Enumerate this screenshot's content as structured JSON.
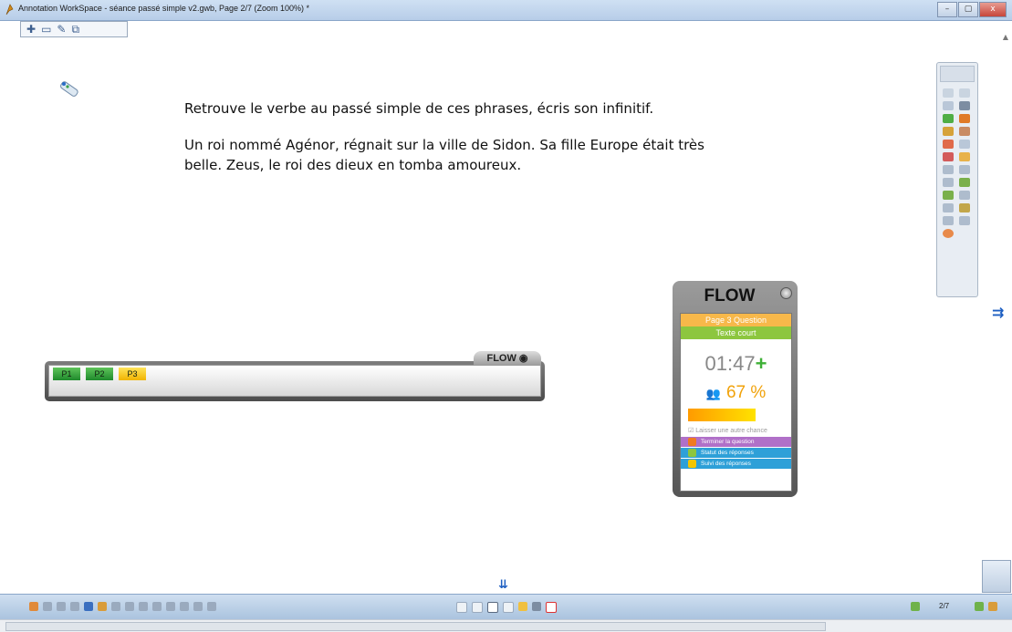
{
  "window": {
    "title": "Annotation WorkSpace - séance passé simple v2.gwb, Page 2/7  (Zoom 100%) *",
    "buttons": [
      "–",
      "▢",
      "x"
    ]
  },
  "mini_toolbar": {
    "icons": [
      "zoom-in-icon",
      "minimize-icon",
      "edit-icon",
      "copy-icon"
    ]
  },
  "content": {
    "instruction": "Retrouve le verbe au passé simple de ces phrases, écris son infinitif.",
    "paragraph_line1": "Un roi nommé Agénor, régnait sur la ville de Sidon. Sa fille Europe était très",
    "paragraph_line2": "belle. Zeus, le roi des dieux en tomba amoureux."
  },
  "participants_bar": {
    "logo": "FLOW",
    "chips": [
      {
        "label": "P1",
        "color": "#2d9c3a"
      },
      {
        "label": "P2",
        "color": "#2d9c3a"
      },
      {
        "label": "P3",
        "color": "#f3c600"
      }
    ]
  },
  "flow_widget": {
    "logo": "FLOW",
    "question_label": "Page 3 Question",
    "question_type": "Texte court",
    "timer": "01:47",
    "timer_plus": "+",
    "percent": "67 %",
    "percent_value": 67,
    "chance_label": "Laisser une autre chance",
    "actions": [
      {
        "label": "Terminer la question",
        "color": "#b070c8"
      },
      {
        "label": "Statut des réponses",
        "color": "#2ea0d8"
      },
      {
        "label": "Suivi des réponses",
        "color": "#2ea0d8"
      }
    ]
  },
  "bottom_bar": {
    "page_label": "2/7"
  },
  "colors": {
    "question_bar": "#f7b84a",
    "type_bar": "#8dc63f"
  }
}
